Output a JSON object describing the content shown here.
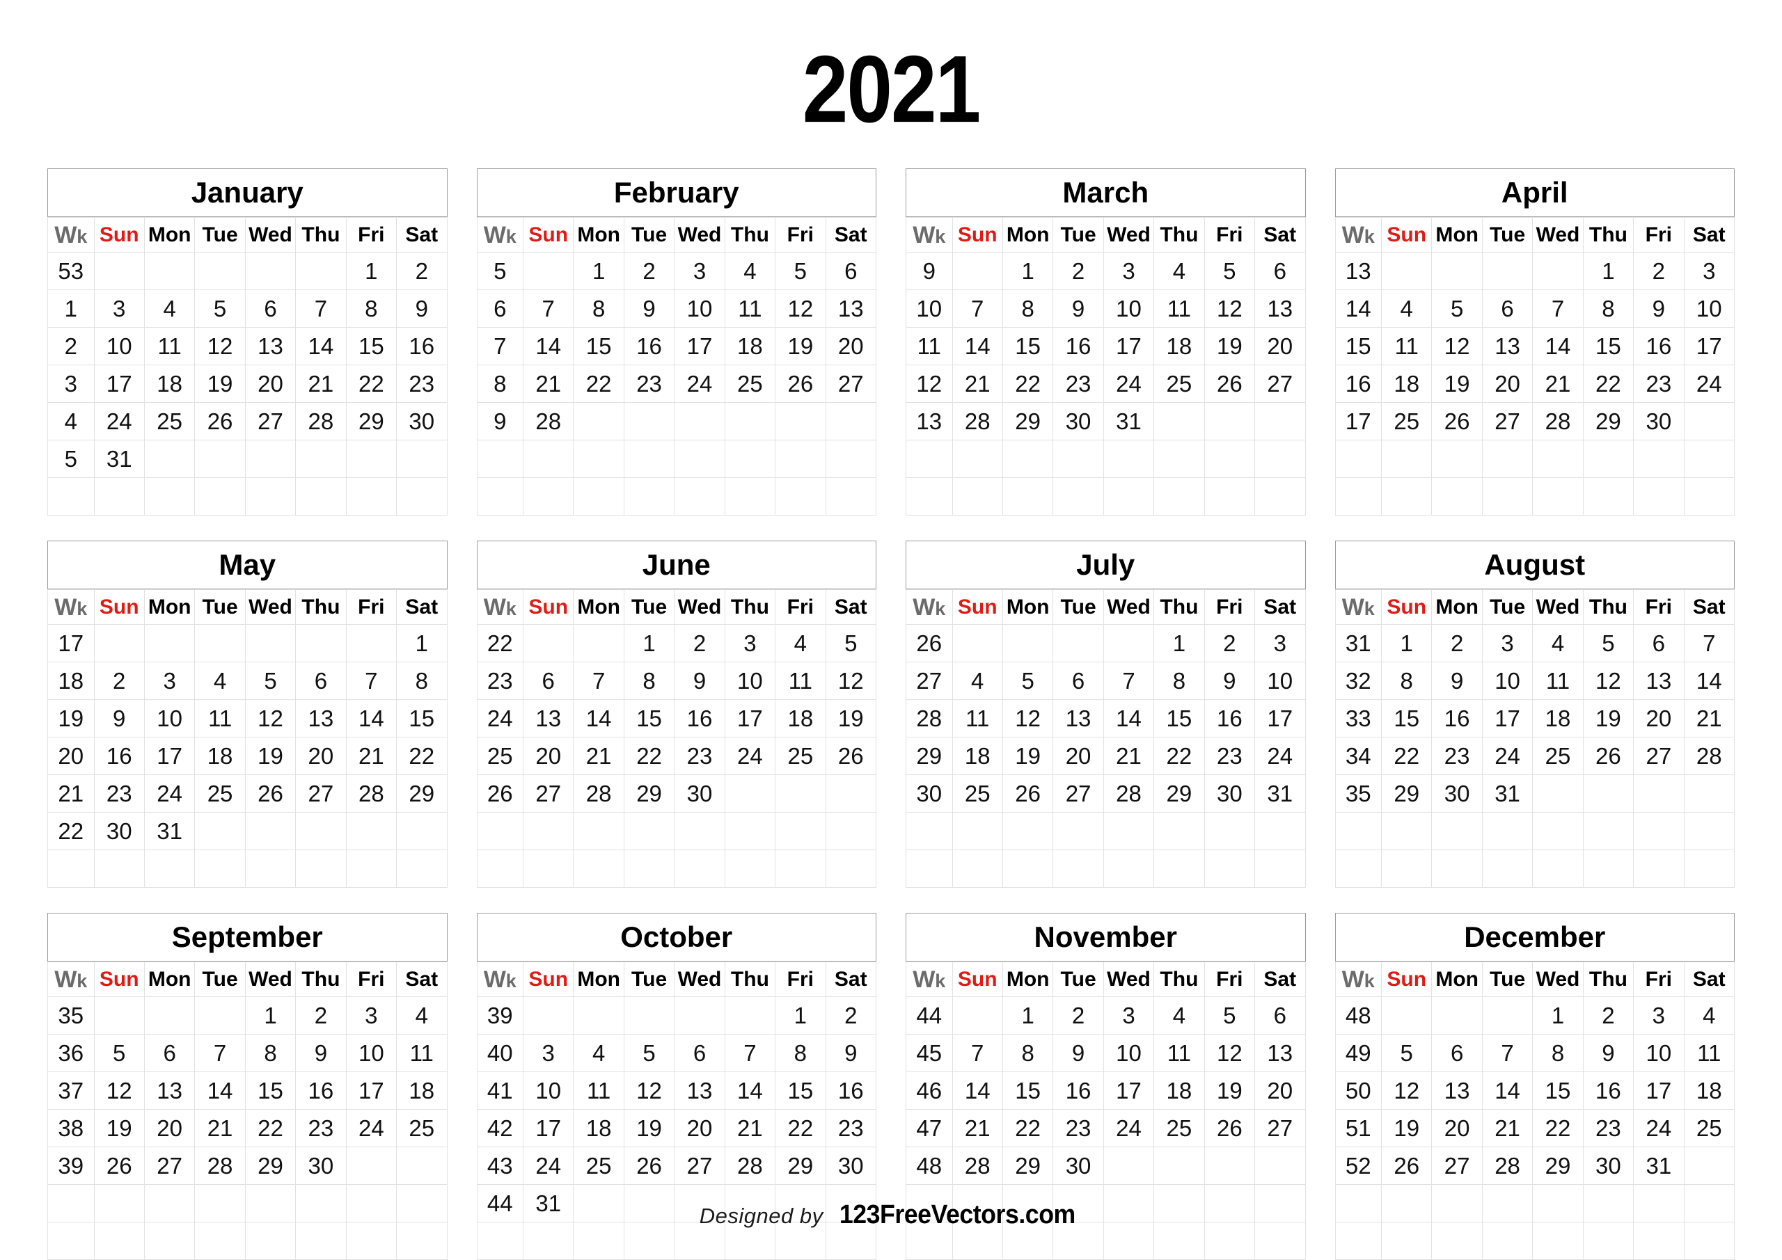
{
  "year_title": "2021",
  "colors": {
    "sunday": "#e01b15",
    "week_number": "#7d7d7d",
    "weekday": "#000000",
    "grid_line": "#e2e2e2",
    "title_box_border": "#9a9a9a",
    "background": "#ffffff"
  },
  "header": {
    "wk_big": "W",
    "wk_small": "k",
    "days": [
      "Sun",
      "Mon",
      "Tue",
      "Wed",
      "Thu",
      "Fri",
      "Sat"
    ]
  },
  "footer": {
    "designed_by": "Designed by",
    "brand": "123FreeVectors.com"
  },
  "chart_data": {
    "type": "table",
    "title": "2021",
    "first_day_of_week": "Sun",
    "week_numbering": "ISO-like week numbers shown in Wk column",
    "months": [
      {
        "name": "January",
        "weeks": [
          53,
          1,
          2,
          3,
          4,
          5
        ],
        "rows": [
          [
            "53",
            "",
            "",
            "",
            "",
            "",
            "1",
            "2"
          ],
          [
            "1",
            "3",
            "4",
            "5",
            "6",
            "7",
            "8",
            "9"
          ],
          [
            "2",
            "10",
            "11",
            "12",
            "13",
            "14",
            "15",
            "16"
          ],
          [
            "3",
            "17",
            "18",
            "19",
            "20",
            "21",
            "22",
            "23"
          ],
          [
            "4",
            "24",
            "25",
            "26",
            "27",
            "28",
            "29",
            "30"
          ],
          [
            "5",
            "31",
            "",
            "",
            "",
            "",
            "",
            ""
          ],
          [
            "",
            "",
            "",
            "",
            "",
            "",
            "",
            ""
          ]
        ]
      },
      {
        "name": "February",
        "weeks": [
          5,
          6,
          7,
          8,
          9
        ],
        "rows": [
          [
            "5",
            "",
            "1",
            "2",
            "3",
            "4",
            "5",
            "6"
          ],
          [
            "6",
            "7",
            "8",
            "9",
            "10",
            "11",
            "12",
            "13"
          ],
          [
            "7",
            "14",
            "15",
            "16",
            "17",
            "18",
            "19",
            "20"
          ],
          [
            "8",
            "21",
            "22",
            "23",
            "24",
            "25",
            "26",
            "27"
          ],
          [
            "9",
            "28",
            "",
            "",
            "",
            "",
            "",
            ""
          ],
          [
            "",
            "",
            "",
            "",
            "",
            "",
            "",
            ""
          ],
          [
            "",
            "",
            "",
            "",
            "",
            "",
            "",
            ""
          ]
        ]
      },
      {
        "name": "March",
        "weeks": [
          9,
          10,
          11,
          12,
          13
        ],
        "rows": [
          [
            "9",
            "",
            "1",
            "2",
            "3",
            "4",
            "5",
            "6"
          ],
          [
            "10",
            "7",
            "8",
            "9",
            "10",
            "11",
            "12",
            "13"
          ],
          [
            "11",
            "14",
            "15",
            "16",
            "17",
            "18",
            "19",
            "20"
          ],
          [
            "12",
            "21",
            "22",
            "23",
            "24",
            "25",
            "26",
            "27"
          ],
          [
            "13",
            "28",
            "29",
            "30",
            "31",
            "",
            "",
            ""
          ],
          [
            "",
            "",
            "",
            "",
            "",
            "",
            "",
            ""
          ],
          [
            "",
            "",
            "",
            "",
            "",
            "",
            "",
            ""
          ]
        ]
      },
      {
        "name": "April",
        "weeks": [
          13,
          14,
          15,
          16,
          17
        ],
        "rows": [
          [
            "13",
            "",
            "",
            "",
            "",
            "1",
            "2",
            "3"
          ],
          [
            "14",
            "4",
            "5",
            "6",
            "7",
            "8",
            "9",
            "10"
          ],
          [
            "15",
            "11",
            "12",
            "13",
            "14",
            "15",
            "16",
            "17"
          ],
          [
            "16",
            "18",
            "19",
            "20",
            "21",
            "22",
            "23",
            "24"
          ],
          [
            "17",
            "25",
            "26",
            "27",
            "28",
            "29",
            "30",
            ""
          ],
          [
            "",
            "",
            "",
            "",
            "",
            "",
            "",
            ""
          ],
          [
            "",
            "",
            "",
            "",
            "",
            "",
            "",
            ""
          ]
        ]
      },
      {
        "name": "May",
        "weeks": [
          17,
          18,
          19,
          20,
          21,
          22
        ],
        "rows": [
          [
            "17",
            "",
            "",
            "",
            "",
            "",
            "",
            "1"
          ],
          [
            "18",
            "2",
            "3",
            "4",
            "5",
            "6",
            "7",
            "8"
          ],
          [
            "19",
            "9",
            "10",
            "11",
            "12",
            "13",
            "14",
            "15"
          ],
          [
            "20",
            "16",
            "17",
            "18",
            "19",
            "20",
            "21",
            "22"
          ],
          [
            "21",
            "23",
            "24",
            "25",
            "26",
            "27",
            "28",
            "29"
          ],
          [
            "22",
            "30",
            "31",
            "",
            "",
            "",
            "",
            ""
          ],
          [
            "",
            "",
            "",
            "",
            "",
            "",
            "",
            ""
          ]
        ]
      },
      {
        "name": "June",
        "weeks": [
          22,
          23,
          24,
          25,
          26
        ],
        "rows": [
          [
            "22",
            "",
            "",
            "1",
            "2",
            "3",
            "4",
            "5"
          ],
          [
            "23",
            "6",
            "7",
            "8",
            "9",
            "10",
            "11",
            "12"
          ],
          [
            "24",
            "13",
            "14",
            "15",
            "16",
            "17",
            "18",
            "19"
          ],
          [
            "25",
            "20",
            "21",
            "22",
            "23",
            "24",
            "25",
            "26"
          ],
          [
            "26",
            "27",
            "28",
            "29",
            "30",
            "",
            "",
            ""
          ],
          [
            "",
            "",
            "",
            "",
            "",
            "",
            "",
            ""
          ],
          [
            "",
            "",
            "",
            "",
            "",
            "",
            "",
            ""
          ]
        ]
      },
      {
        "name": "July",
        "weeks": [
          26,
          27,
          28,
          29,
          30
        ],
        "rows": [
          [
            "26",
            "",
            "",
            "",
            "",
            "1",
            "2",
            "3"
          ],
          [
            "27",
            "4",
            "5",
            "6",
            "7",
            "8",
            "9",
            "10"
          ],
          [
            "28",
            "11",
            "12",
            "13",
            "14",
            "15",
            "16",
            "17"
          ],
          [
            "29",
            "18",
            "19",
            "20",
            "21",
            "22",
            "23",
            "24"
          ],
          [
            "30",
            "25",
            "26",
            "27",
            "28",
            "29",
            "30",
            "31"
          ],
          [
            "",
            "",
            "",
            "",
            "",
            "",
            "",
            ""
          ],
          [
            "",
            "",
            "",
            "",
            "",
            "",
            "",
            ""
          ]
        ]
      },
      {
        "name": "August",
        "weeks": [
          31,
          32,
          33,
          34,
          35
        ],
        "rows": [
          [
            "31",
            "1",
            "2",
            "3",
            "4",
            "5",
            "6",
            "7"
          ],
          [
            "32",
            "8",
            "9",
            "10",
            "11",
            "12",
            "13",
            "14"
          ],
          [
            "33",
            "15",
            "16",
            "17",
            "18",
            "19",
            "20",
            "21"
          ],
          [
            "34",
            "22",
            "23",
            "24",
            "25",
            "26",
            "27",
            "28"
          ],
          [
            "35",
            "29",
            "30",
            "31",
            "",
            "",
            "",
            ""
          ],
          [
            "",
            "",
            "",
            "",
            "",
            "",
            "",
            ""
          ],
          [
            "",
            "",
            "",
            "",
            "",
            "",
            "",
            ""
          ]
        ]
      },
      {
        "name": "September",
        "weeks": [
          35,
          36,
          37,
          38,
          39
        ],
        "rows": [
          [
            "35",
            "",
            "",
            "",
            "1",
            "2",
            "3",
            "4"
          ],
          [
            "36",
            "5",
            "6",
            "7",
            "8",
            "9",
            "10",
            "11"
          ],
          [
            "37",
            "12",
            "13",
            "14",
            "15",
            "16",
            "17",
            "18"
          ],
          [
            "38",
            "19",
            "20",
            "21",
            "22",
            "23",
            "24",
            "25"
          ],
          [
            "39",
            "26",
            "27",
            "28",
            "29",
            "30",
            "",
            ""
          ],
          [
            "",
            "",
            "",
            "",
            "",
            "",
            "",
            ""
          ],
          [
            "",
            "",
            "",
            "",
            "",
            "",
            "",
            ""
          ]
        ]
      },
      {
        "name": "October",
        "weeks": [
          39,
          40,
          41,
          42,
          43,
          44
        ],
        "rows": [
          [
            "39",
            "",
            "",
            "",
            "",
            "",
            "1",
            "2"
          ],
          [
            "40",
            "3",
            "4",
            "5",
            "6",
            "7",
            "8",
            "9"
          ],
          [
            "41",
            "10",
            "11",
            "12",
            "13",
            "14",
            "15",
            "16"
          ],
          [
            "42",
            "17",
            "18",
            "19",
            "20",
            "21",
            "22",
            "23"
          ],
          [
            "43",
            "24",
            "25",
            "26",
            "27",
            "28",
            "29",
            "30"
          ],
          [
            "44",
            "31",
            "",
            "",
            "",
            "",
            "",
            ""
          ],
          [
            "",
            "",
            "",
            "",
            "",
            "",
            "",
            ""
          ]
        ]
      },
      {
        "name": "November",
        "weeks": [
          44,
          45,
          46,
          47,
          48
        ],
        "rows": [
          [
            "44",
            "",
            "1",
            "2",
            "3",
            "4",
            "5",
            "6"
          ],
          [
            "45",
            "7",
            "8",
            "9",
            "10",
            "11",
            "12",
            "13"
          ],
          [
            "46",
            "14",
            "15",
            "16",
            "17",
            "18",
            "19",
            "20"
          ],
          [
            "47",
            "21",
            "22",
            "23",
            "24",
            "25",
            "26",
            "27"
          ],
          [
            "48",
            "28",
            "29",
            "30",
            "",
            "",
            "",
            ""
          ],
          [
            "",
            "",
            "",
            "",
            "",
            "",
            "",
            ""
          ],
          [
            "",
            "",
            "",
            "",
            "",
            "",
            "",
            ""
          ]
        ]
      },
      {
        "name": "December",
        "weeks": [
          48,
          49,
          50,
          51,
          52
        ],
        "rows": [
          [
            "48",
            "",
            "",
            "",
            "1",
            "2",
            "3",
            "4"
          ],
          [
            "49",
            "5",
            "6",
            "7",
            "8",
            "9",
            "10",
            "11"
          ],
          [
            "50",
            "12",
            "13",
            "14",
            "15",
            "16",
            "17",
            "18"
          ],
          [
            "51",
            "19",
            "20",
            "21",
            "22",
            "23",
            "24",
            "25"
          ],
          [
            "52",
            "26",
            "27",
            "28",
            "29",
            "30",
            "31",
            ""
          ],
          [
            "",
            "",
            "",
            "",
            "",
            "",
            "",
            ""
          ],
          [
            "",
            "",
            "",
            "",
            "",
            "",
            "",
            ""
          ]
        ]
      }
    ]
  }
}
